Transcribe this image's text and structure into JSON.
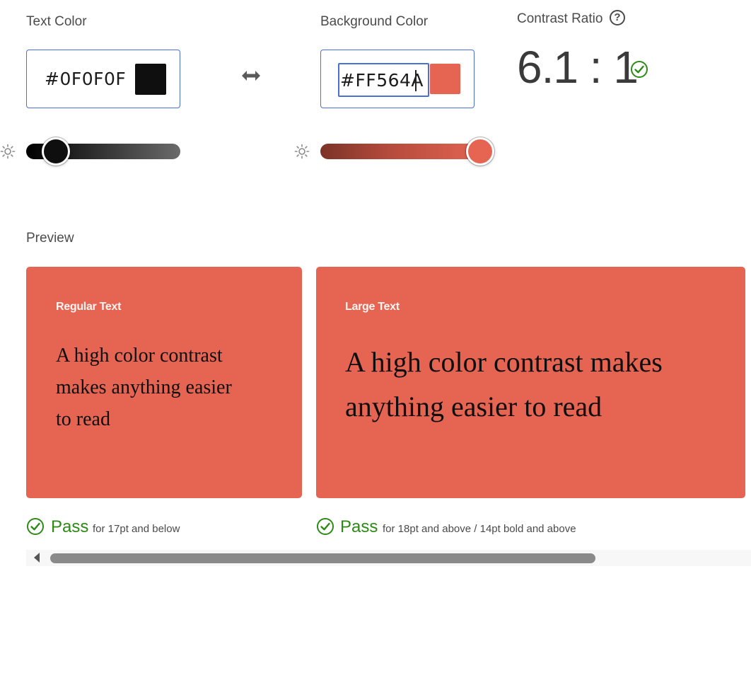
{
  "colors": {
    "text": "#0F0F0F",
    "background": "#FF564A",
    "card_bg": "#E56452",
    "swatch_bg": "#E56452",
    "pass_green": "#2d8a14",
    "focus_blue": "#4a6fd6"
  },
  "text_color": {
    "label": "Text Color",
    "value": "#0F0F0F",
    "brightness_icon": "sun-icon",
    "brightness_level": 0.2
  },
  "swap_icon": "swap-arrows-icon",
  "background_color": {
    "label": "Background Color",
    "value": "#FF564A",
    "brightness_icon": "sun-icon",
    "brightness_level": 1.0
  },
  "contrast": {
    "label": "Contrast Ratio",
    "help_icon": "help-icon",
    "help_glyph": "?",
    "value": "6.1 : 1",
    "status_icon": "check-circle-icon"
  },
  "preview": {
    "heading": "Preview",
    "regular": {
      "title": "Regular Text",
      "text_lines": [
        "A high color contrast",
        "makes anything easier",
        "to read"
      ],
      "result": "Pass",
      "note": "for 17pt and below"
    },
    "large": {
      "title": "Large Text",
      "text_lines": [
        "A high color contrast makes",
        "anything easier to read"
      ],
      "result": "Pass",
      "note": "for 18pt and above / 14pt bold and above"
    }
  },
  "scrollbar": {
    "left_arrow_icon": "scroll-left-arrow-icon",
    "position": 0.0
  }
}
